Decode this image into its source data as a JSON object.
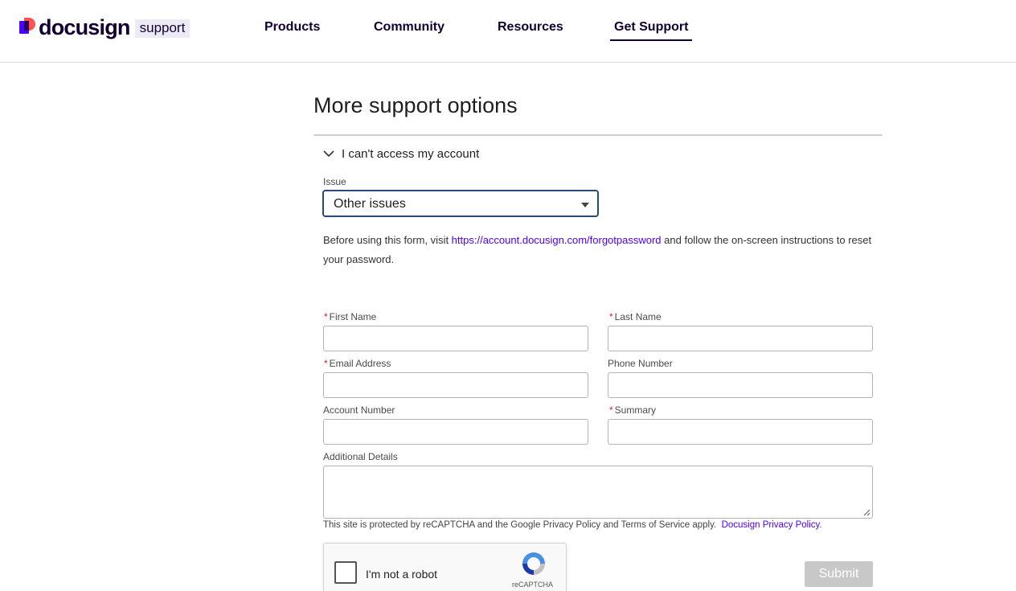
{
  "header": {
    "logo_text": "docusign",
    "logo_badge": "support",
    "nav": [
      {
        "label": "Products"
      },
      {
        "label": "Community"
      },
      {
        "label": "Resources"
      },
      {
        "label": "Get Support",
        "active": true
      }
    ]
  },
  "main": {
    "title": "More support options",
    "accordion_title": "I can't access my account",
    "issue_label": "Issue",
    "issue_value": "Other issues",
    "help_prefix": "Before using this form, visit ",
    "help_link": "https://account.docusign.com/forgotpassword",
    "help_suffix": " and follow the on-screen instructions to reset your password."
  },
  "form": {
    "required_mark": "*",
    "first_name_label": "First Name",
    "last_name_label": "Last Name",
    "email_label": "Email Address",
    "phone_label": "Phone Number",
    "account_label": "Account Number",
    "summary_label": "Summary",
    "details_label": "Additional Details",
    "first_name_value": "",
    "last_name_value": "",
    "email_value": "",
    "phone_value": "",
    "account_value": "",
    "summary_value": "",
    "details_value": "",
    "recaptcha_note": "This site is protected by reCAPTCHA and the Google Privacy Policy and Terms of Service apply.",
    "privacy_link": "Docusign Privacy Policy",
    "privacy_suffix": ".",
    "captcha_label": "I'm not a robot",
    "captcha_brand": "reCAPTCHA",
    "submit_label": "Submit"
  },
  "colors": {
    "brand_purple": "#4c00ff",
    "brand_dark": "#130032",
    "required_red": "#c9252c",
    "submit_disabled": "#c8c8c8"
  },
  "icons": {
    "accordion": "chevron-down-icon",
    "select": "caret-down-icon",
    "captcha": "recaptcha-icon",
    "resize": "resize-handle-icon"
  }
}
